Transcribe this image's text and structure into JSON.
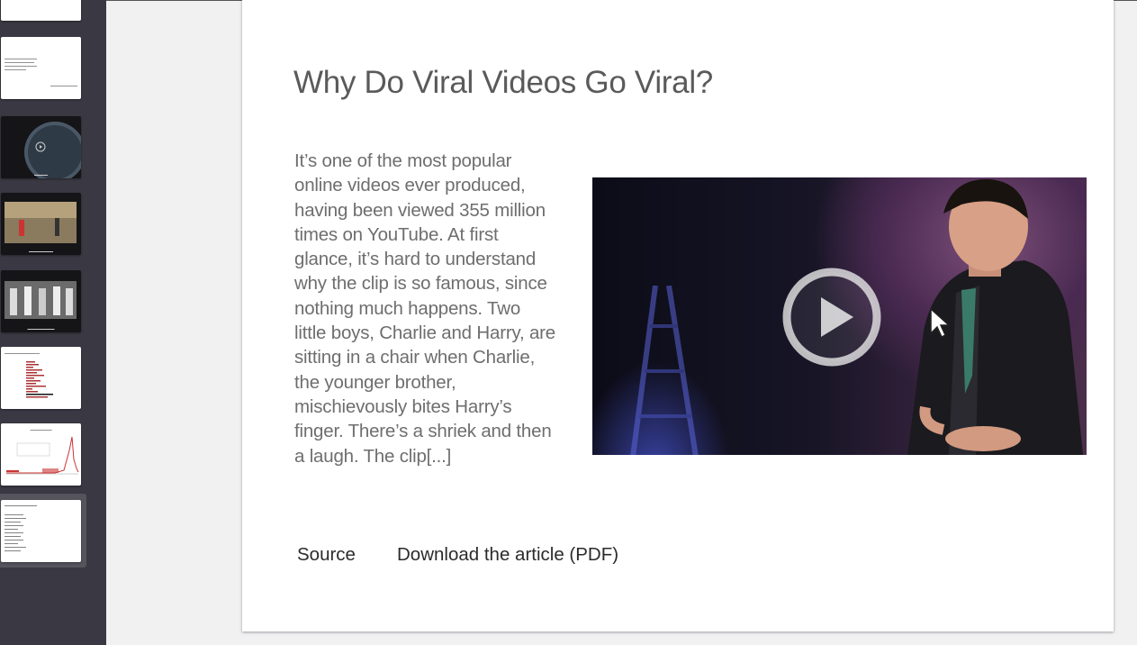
{
  "slide": {
    "title": "Why Do Viral Videos Go Viral?",
    "body": "It’s one of the most popular online videos ever produced, having been viewed 355 million times on YouTube. At first glance, it’s hard to understand why the clip is so famous, since nothing much happens. Two little boys, Charlie and Harry, are sitting in a chair when Charlie, the younger brother, mischievously bites Harry’s finger. There’s a shriek and then a laugh. The clip[...]",
    "links": {
      "source": "Source",
      "download": "Download the article (PDF)"
    }
  },
  "sidebar": {
    "selected_index": 7
  },
  "colors": {
    "sidebar_bg": "#3a3943",
    "canvas_bg": "#f1f1f2",
    "title": "#5a5a5a",
    "body": "#6e6e6e"
  }
}
